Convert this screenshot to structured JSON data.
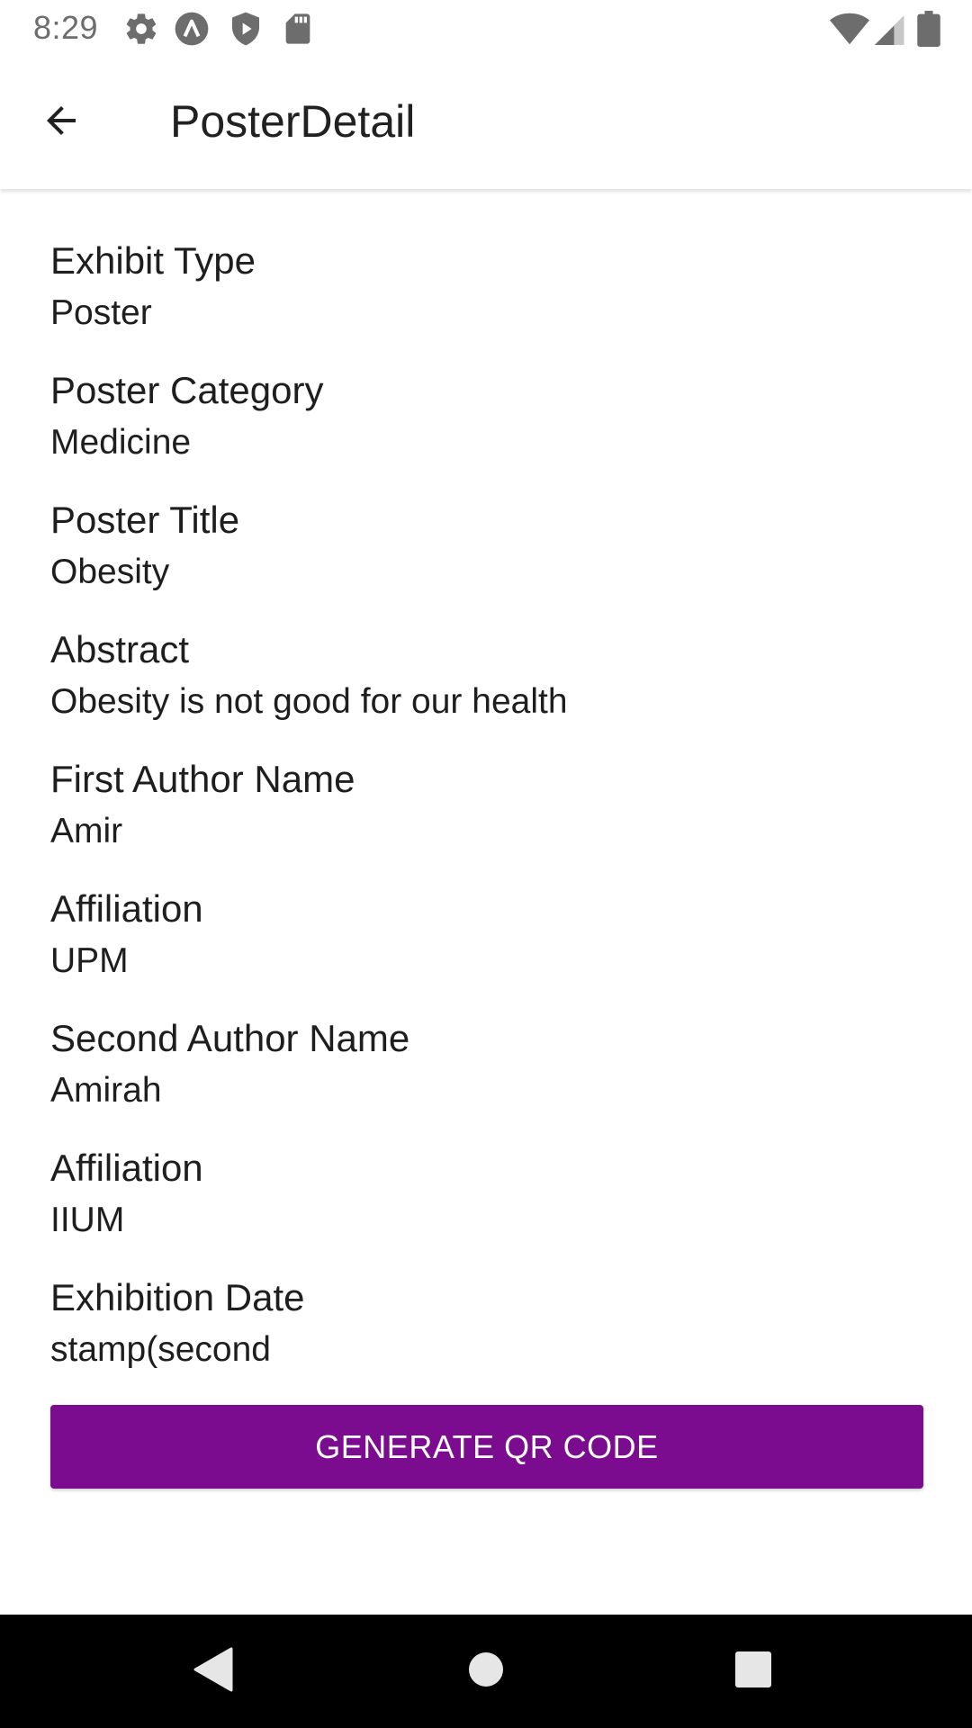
{
  "status_bar": {
    "time": "8:29",
    "icons": [
      "gear-icon",
      "a-circle-icon",
      "shield-play-icon",
      "sd-card-icon",
      "wifi-icon",
      "cell-signal-icon",
      "battery-icon"
    ]
  },
  "app_bar": {
    "title": "PosterDetail",
    "back_icon": "arrow-back-icon"
  },
  "fields": [
    {
      "label": "Exhibit Type",
      "value": "Poster"
    },
    {
      "label": "Poster Category",
      "value": "Medicine"
    },
    {
      "label": "Poster Title",
      "value": "Obesity"
    },
    {
      "label": "Abstract",
      "value": "Obesity is not good for our health"
    },
    {
      "label": "First Author Name",
      "value": "Amir"
    },
    {
      "label": "Affiliation",
      "value": "UPM"
    },
    {
      "label": "Second Author Name",
      "value": "Amirah"
    },
    {
      "label": "Affiliation",
      "value": "IIUM"
    },
    {
      "label": "Exhibition Date",
      "value": "stamp(second"
    }
  ],
  "actions": {
    "generate_qr_label": "GENERATE QR CODE"
  },
  "colors": {
    "button": "#7b0b8f",
    "nav_bar": "#000000",
    "status_icons": "#6d6d6d"
  }
}
